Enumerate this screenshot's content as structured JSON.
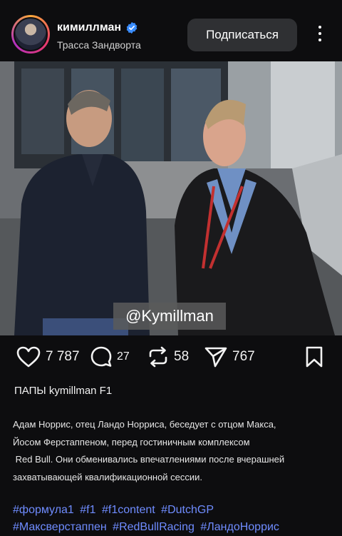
{
  "header": {
    "username": "кимиллман",
    "location": "Трасса Зандворта",
    "follow_label": "Подписаться"
  },
  "photo": {
    "watermark": "@Kymillman"
  },
  "actions": {
    "likes": "7 787",
    "comments": "27",
    "reposts": "58",
    "shares": "767"
  },
  "post": {
    "title": "ПАПЫ kymillman F1",
    "caption_lines": [
      "Адам Норрис, отец Ландо Норриса, беседует с отцом Макса,",
      "Йосом Ферстаппеном, перед гостиничным комплексом",
      " Red Bull. Они обменивались впечатлениями после вчерашней",
      "захватывающей квалификационной сессии."
    ],
    "hashtags": [
      "#формула1",
      "#f1",
      "#f1content",
      "#DutchGP",
      "#Максверстаппен",
      "#RedBullRacing",
      "#ЛандоНоррис"
    ]
  },
  "colors": {
    "background": "#0d0d0f",
    "verified": "#3a8dff",
    "hashtag": "#6f8cff",
    "button": "#2f3033"
  }
}
